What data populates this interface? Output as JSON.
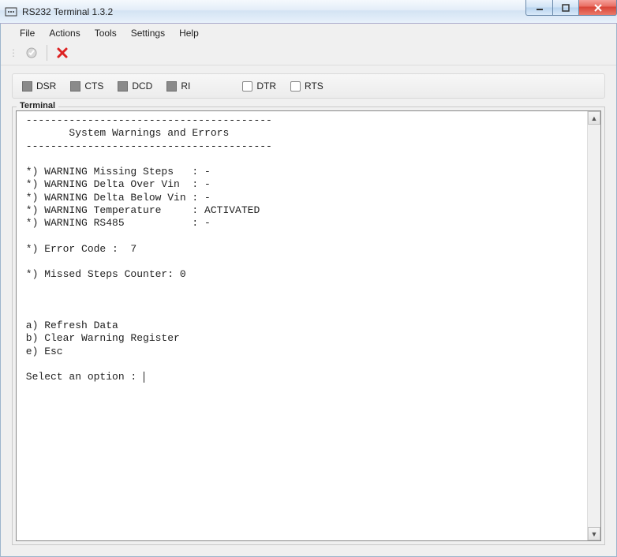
{
  "window": {
    "title": "RS232 Terminal 1.3.2"
  },
  "menu": {
    "file": "File",
    "actions": "Actions",
    "tools": "Tools",
    "settings": "Settings",
    "help": "Help"
  },
  "signals": {
    "dsr": "DSR",
    "cts": "CTS",
    "dcd": "DCD",
    "ri": "RI",
    "dtr": "DTR",
    "rts": "RTS"
  },
  "terminal": {
    "group_label": "Terminal",
    "content": " ----------------------------------------\n        System Warnings and Errors\n ----------------------------------------\n\n *) WARNING Missing Steps   : -\n *) WARNING Delta Over Vin  : -\n *) WARNING Delta Below Vin : -\n *) WARNING Temperature     : ACTIVATED\n *) WARNING RS485           : -\n\n *) Error Code :  7\n\n *) Missed Steps Counter: 0\n\n\n\n a) Refresh Data\n b) Clear Warning Register\n e) Esc\n\n Select an option : "
  }
}
